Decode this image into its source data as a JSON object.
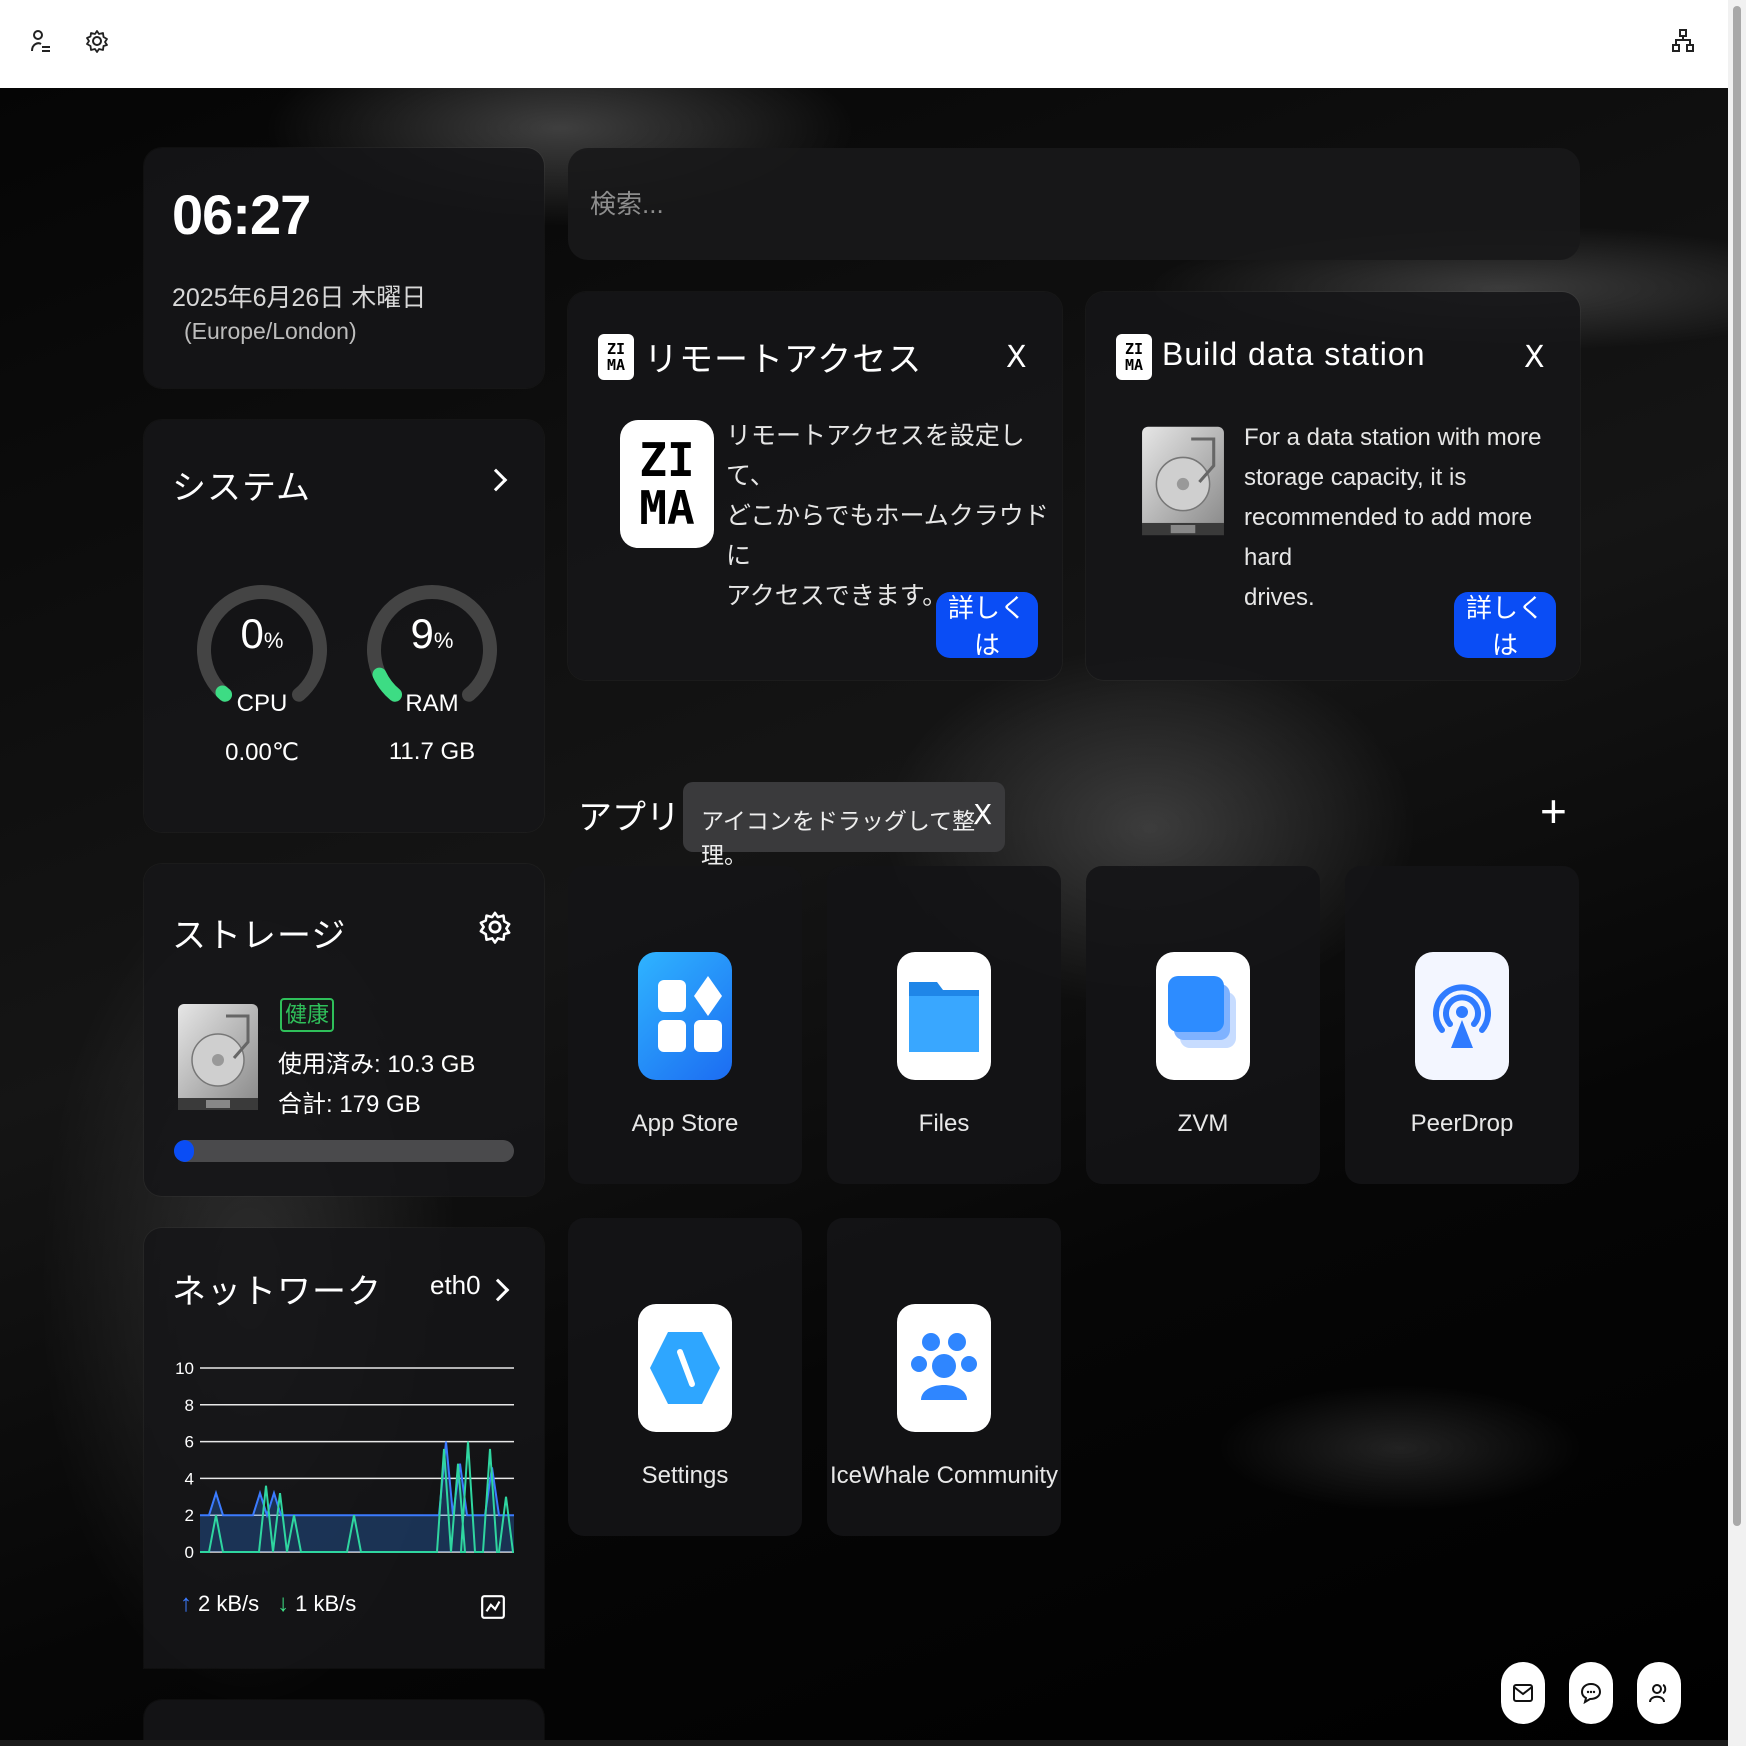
{
  "clock": {
    "time": "06:27",
    "date": "2025年6月26日 木曜日",
    "timezone": "(Europe/London)"
  },
  "search": {
    "placeholder": "検索..."
  },
  "system": {
    "title": "システム",
    "cpu": {
      "percent": "0",
      "unit": "%",
      "label": "CPU",
      "temp": "0.00℃",
      "level": 0.0
    },
    "ram": {
      "percent": "9",
      "unit": "%",
      "label": "RAM",
      "size": "11.7 GB",
      "level": 0.09
    }
  },
  "storage": {
    "title": "ストレージ",
    "badge": "健康",
    "used": "使用済み: 10.3 GB",
    "total": "合計: 179 GB",
    "usage_fraction": 0.058
  },
  "network": {
    "title": "ネットワーク",
    "interface": "eth0",
    "up": "2 kB/s",
    "down": "1 kB/s",
    "yticks": [
      "10",
      "8",
      "6",
      "4",
      "2",
      "0"
    ]
  },
  "remote_card": {
    "title": "リモートアクセス",
    "logo": "ZI MA",
    "body": [
      "リモートアクセスを設定して、",
      "どこからでもホームクラウドに",
      "アクセスできます。"
    ],
    "button": "詳しくは",
    "close": "X"
  },
  "datastation_card": {
    "title": "Build data station",
    "logo": "ZI MA",
    "body": [
      "For a data station with more",
      "storage capacity, it is",
      "recommended to add more hard",
      "drives."
    ],
    "button": "詳しくは",
    "close": "X"
  },
  "apps": {
    "title": "アプリ",
    "tooltip": "アイコンをドラッグして整理。",
    "tooltip_close": "X",
    "add": "+",
    "items": [
      {
        "name": "App Store",
        "icon": "app-store-icon"
      },
      {
        "name": "Files",
        "icon": "folder-icon"
      },
      {
        "name": "ZVM",
        "icon": "zvm-icon"
      },
      {
        "name": "PeerDrop",
        "icon": "peerdrop-icon"
      },
      {
        "name": "Settings",
        "icon": "settings-app-icon"
      },
      {
        "name": "IceWhale Community",
        "icon": "community-icon"
      }
    ]
  },
  "colors": {
    "accent_blue": "#0a4df5",
    "green": "#3ddc84",
    "badge_green": "#2fbf5a"
  }
}
